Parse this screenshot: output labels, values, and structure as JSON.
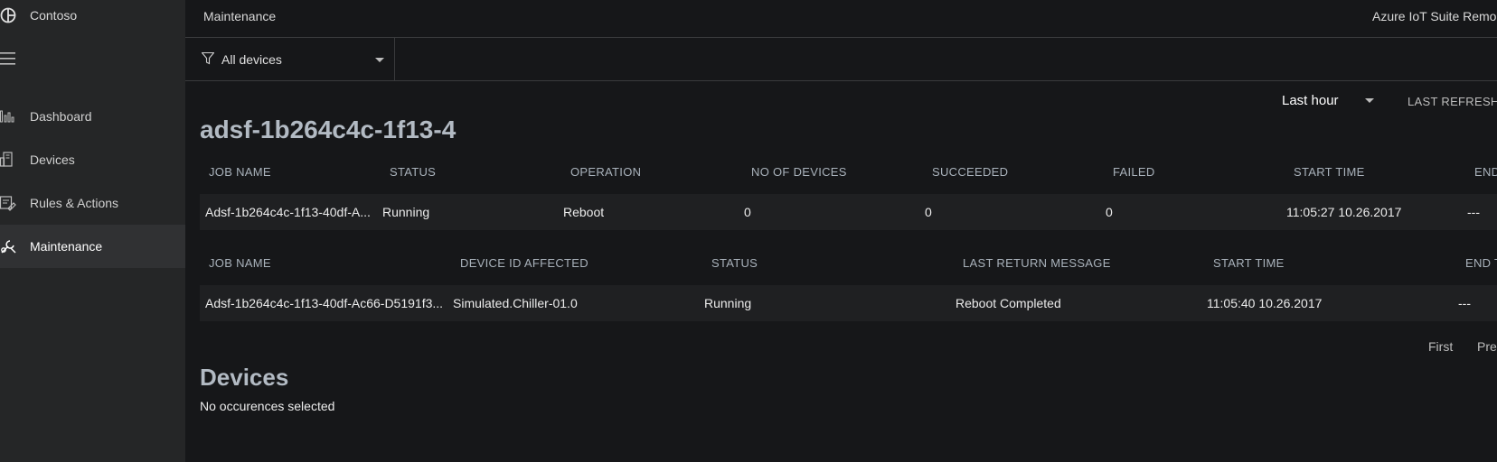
{
  "sidebar": {
    "brand": "Contoso",
    "items": [
      {
        "label": "Dashboard"
      },
      {
        "label": "Devices"
      },
      {
        "label": "Rules & Actions"
      },
      {
        "label": "Maintenance"
      }
    ]
  },
  "header": {
    "title": "Maintenance",
    "suite": "Azure IoT Suite Remo"
  },
  "filter": {
    "selected": "All devices"
  },
  "time_range": {
    "selected": "Last hour",
    "last_refresh": "LAST REFRESH"
  },
  "job": {
    "title": "adsf-1b264c4c-1f13-4"
  },
  "jobs_table": {
    "columns": [
      "JOB NAME",
      "STATUS",
      "OPERATION",
      "NO OF DEVICES",
      "SUCCEEDED",
      "FAILED",
      "START TIME",
      "END"
    ],
    "rows": [
      [
        "Adsf-1b264c4c-1f13-40df-A...",
        "Running",
        "Reboot",
        "0",
        "0",
        "0",
        "11:05:27 10.26.2017",
        "---"
      ]
    ]
  },
  "device_jobs_table": {
    "columns": [
      "JOB NAME",
      "DEVICE ID AFFECTED",
      "STATUS",
      "LAST RETURN MESSAGE",
      "START TIME",
      "END T"
    ],
    "rows": [
      [
        "Adsf-1b264c4c-1f13-40df-Ac66-D5191f3...",
        "Simulated.Chiller-01.0",
        "Running",
        "Reboot Completed",
        "11:05:40 10.26.2017",
        "---"
      ]
    ]
  },
  "pager": {
    "first": "First",
    "prev": "Pre"
  },
  "devices": {
    "title": "Devices",
    "empty": "No occurences selected"
  },
  "colors": {
    "background": "#161719",
    "sidebar": "#252627",
    "active_item": "#303133",
    "row": "#1f2022",
    "heading": "#b2bac3"
  }
}
